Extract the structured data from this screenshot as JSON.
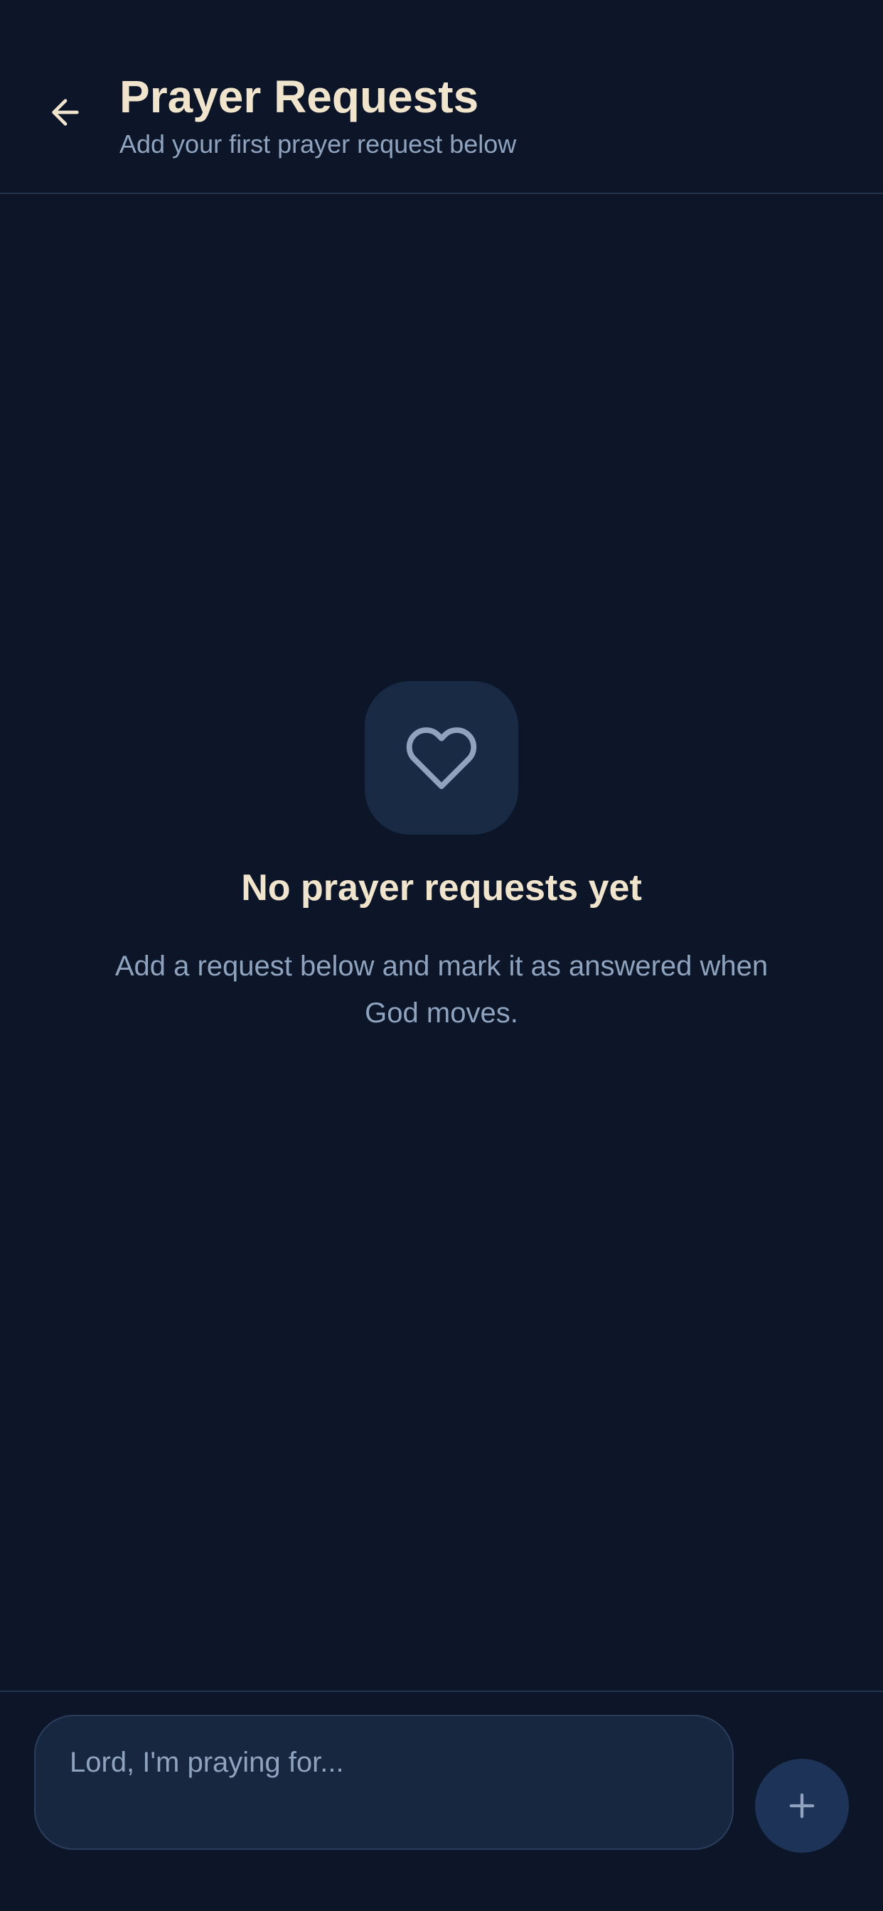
{
  "header": {
    "back_icon": "arrow-left-icon",
    "title": "Prayer Requests",
    "subtitle": "Add your first prayer request below"
  },
  "empty_state": {
    "icon": "heart-icon",
    "title": "No prayer requests yet",
    "description": "Add a request below and mark it as answered when God moves."
  },
  "composer": {
    "placeholder": "Lord, I'm praying for...",
    "value": "",
    "add_icon": "plus-icon"
  },
  "colors": {
    "background": "#0c1628",
    "title_text": "#f1e4cc",
    "muted_text": "#8fa3bf",
    "icon_box": "#192a45",
    "input_bg": "#172740",
    "add_button_bg": "#1d3357",
    "divider": "#24344f"
  }
}
